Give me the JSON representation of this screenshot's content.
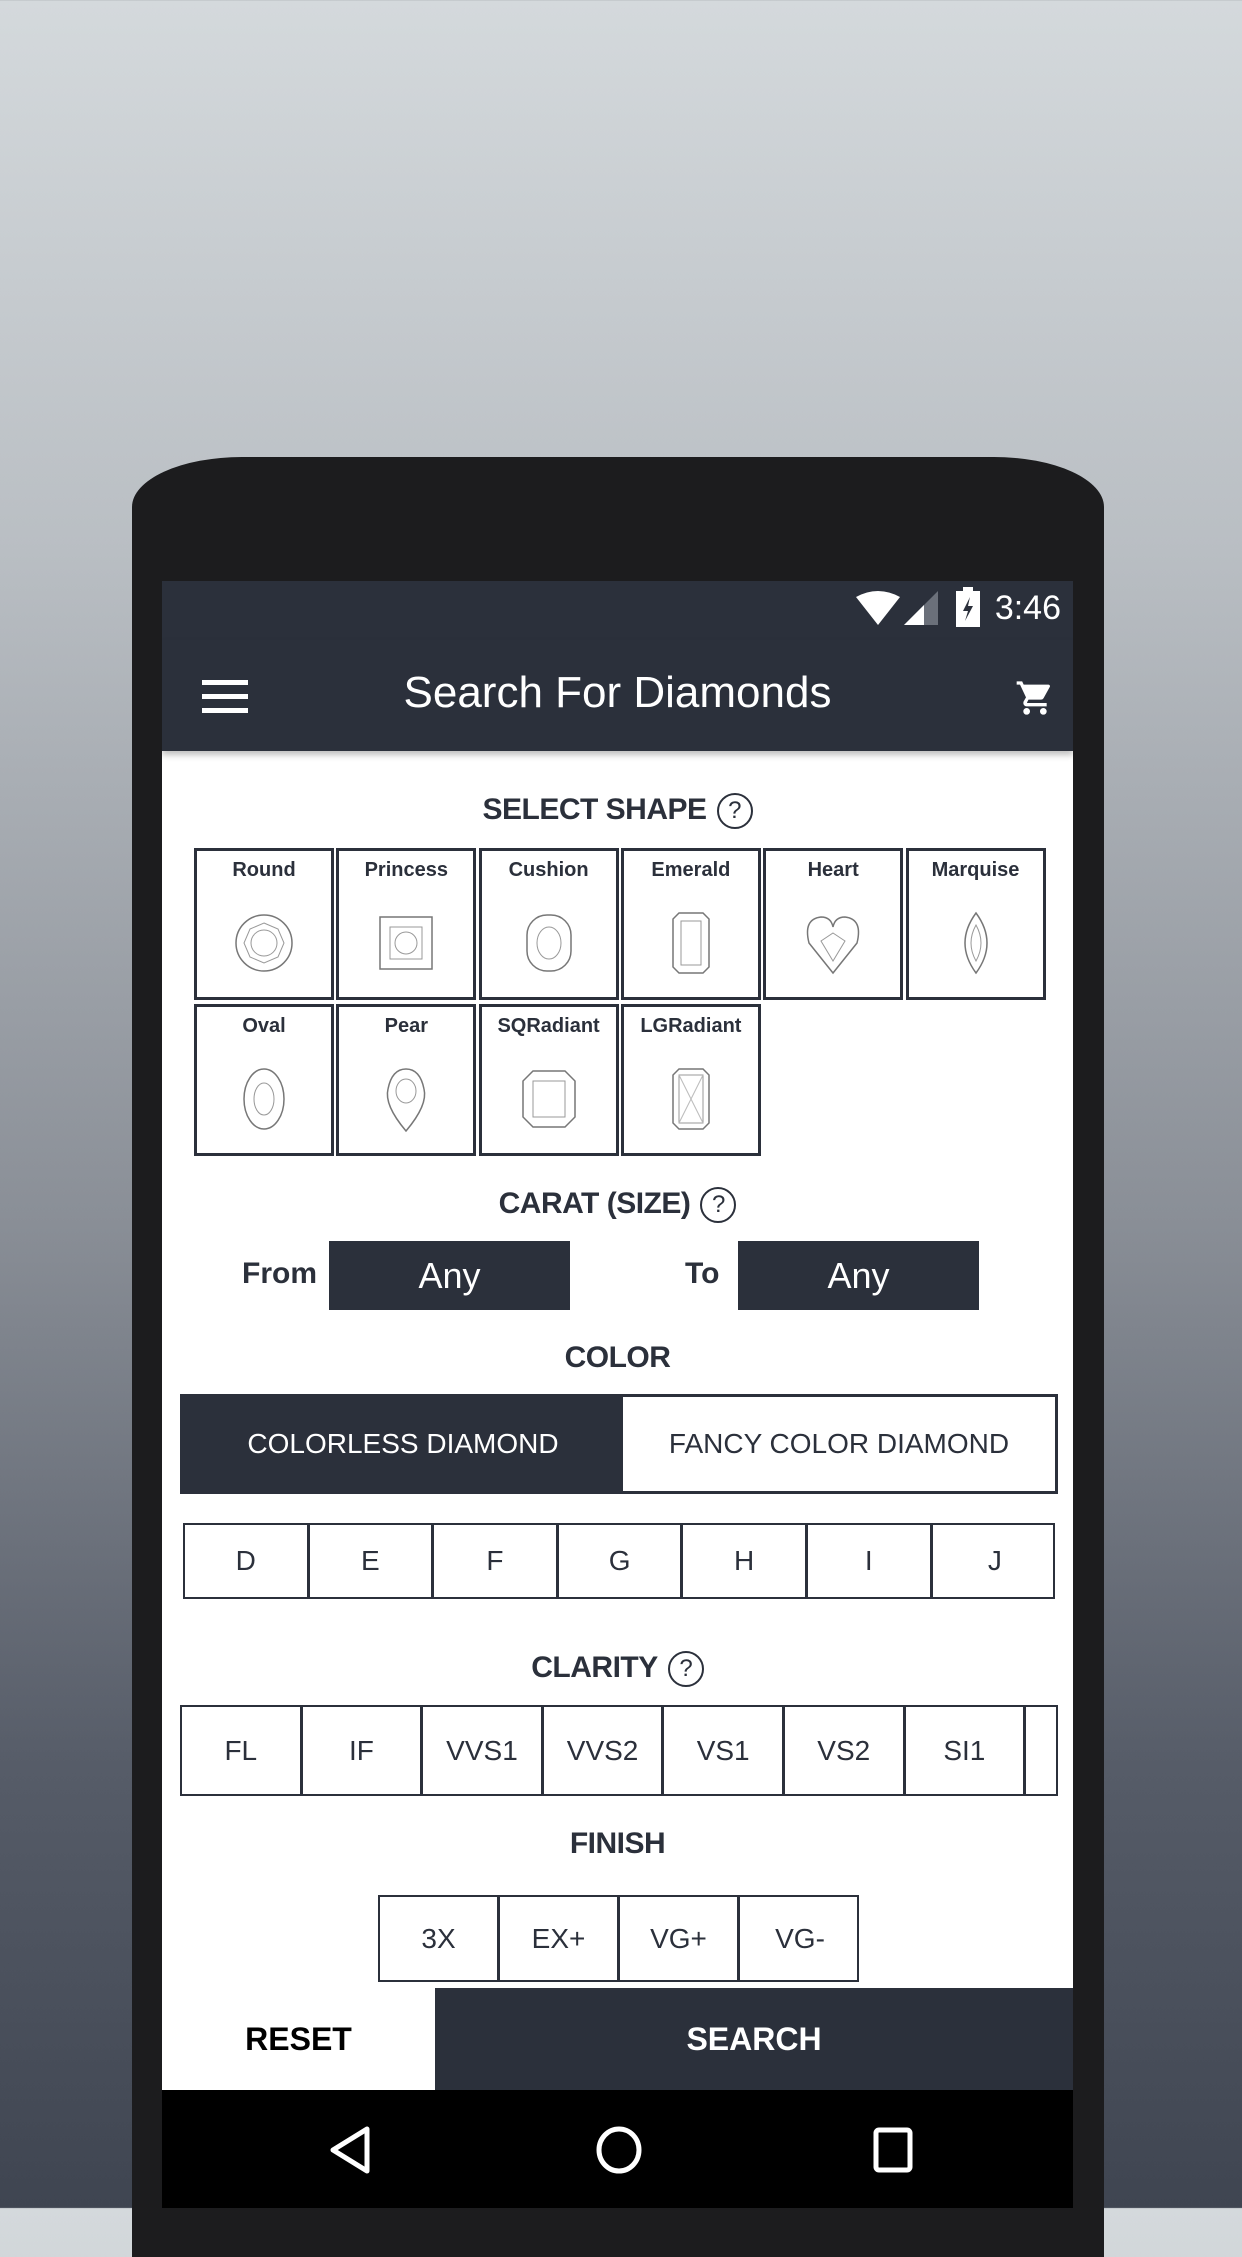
{
  "status_bar": {
    "time": "3:46"
  },
  "app_bar": {
    "title": "Search For Diamonds",
    "menu_icon": "hamburger-menu-icon",
    "cart_icon": "shopping-cart-icon"
  },
  "shape": {
    "label": "SELECT SHAPE",
    "help": "?",
    "items": [
      {
        "label": "Round"
      },
      {
        "label": "Princess"
      },
      {
        "label": "Cushion"
      },
      {
        "label": "Emerald"
      },
      {
        "label": "Heart"
      },
      {
        "label": "Marquise"
      },
      {
        "label": "Oval"
      },
      {
        "label": "Pear"
      },
      {
        "label": "SQRadiant"
      },
      {
        "label": "LGRadiant"
      }
    ]
  },
  "carat": {
    "label": "CARAT (SIZE)",
    "help": "?",
    "from_label": "From",
    "from_value": "Any",
    "to_label": "To",
    "to_value": "Any"
  },
  "color": {
    "label": "COLOR",
    "tabs": [
      {
        "label": "COLORLESS DIAMOND",
        "selected": true
      },
      {
        "label": "FANCY COLOR DIAMOND",
        "selected": false
      }
    ],
    "grades": [
      "D",
      "E",
      "F",
      "G",
      "H",
      "I",
      "J"
    ]
  },
  "clarity": {
    "label": "CLARITY",
    "help": "?",
    "grades": [
      "FL",
      "IF",
      "VVS1",
      "VVS2",
      "VS1",
      "VS2",
      "SI1"
    ]
  },
  "finish": {
    "label": "FINISH",
    "grades": [
      "3X",
      "EX+",
      "VG+",
      "VG-"
    ]
  },
  "actions": {
    "reset": "RESET",
    "search": "SEARCH"
  },
  "colors": {
    "primary": "#2b303b",
    "background": "#ffffff"
  }
}
